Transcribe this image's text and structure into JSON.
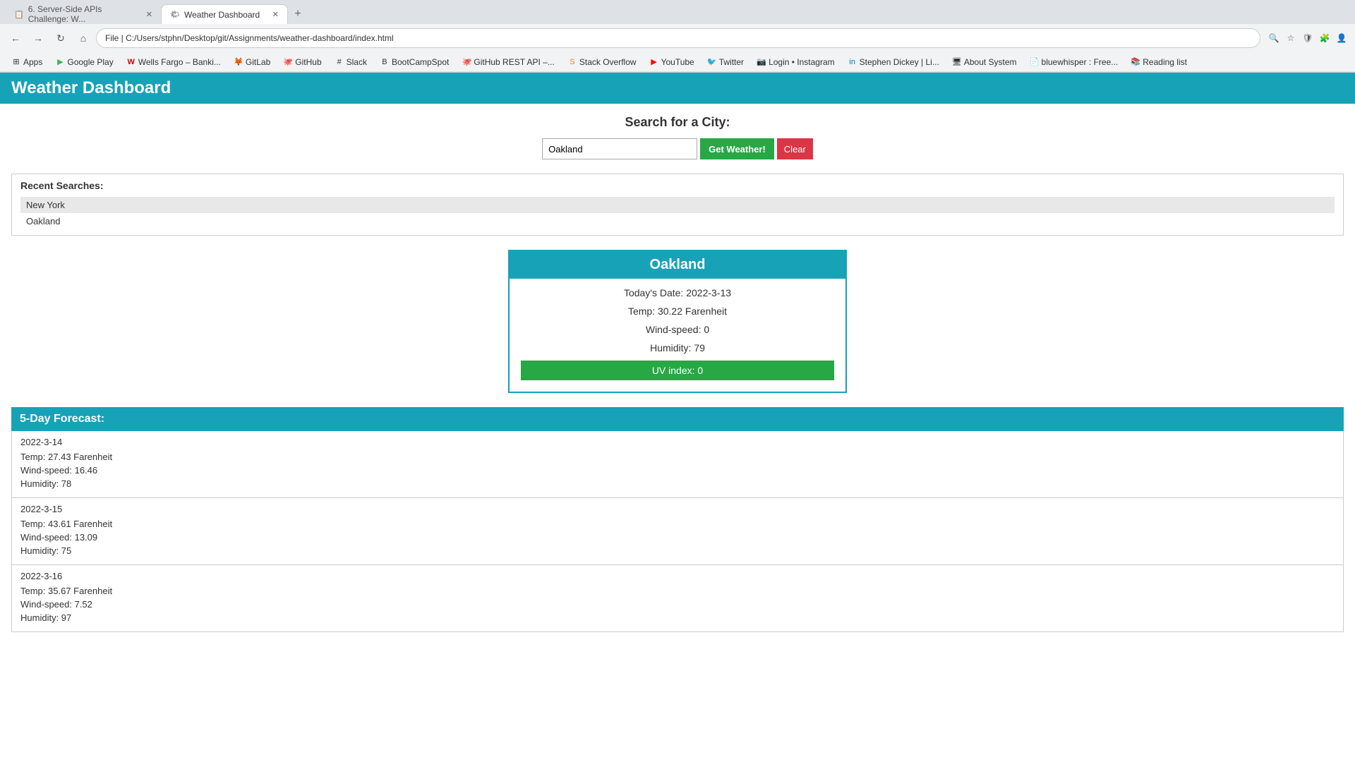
{
  "browser": {
    "tabs": [
      {
        "id": "tab1",
        "favicon": "📋",
        "title": "6. Server-Side APIs Challenge: W...",
        "active": false
      },
      {
        "id": "tab2",
        "favicon": "🌤",
        "title": "Weather Dashboard",
        "active": true
      }
    ],
    "new_tab_label": "+",
    "address_bar_value": "File | C:/Users/stphn/Desktop/git/Assignments/weather-dashboard/index.html",
    "bookmarks": [
      {
        "id": "bk-apps",
        "icon": "⊞",
        "label": "Apps"
      },
      {
        "id": "bk-google-play",
        "icon": "▶",
        "label": "Google Play"
      },
      {
        "id": "bk-wells-fargo",
        "icon": "W",
        "label": "Wells Fargo – Banki..."
      },
      {
        "id": "bk-gitlab",
        "icon": "🦊",
        "label": "GitLab"
      },
      {
        "id": "bk-github",
        "icon": "🐙",
        "label": "GitHub"
      },
      {
        "id": "bk-slack",
        "icon": "#",
        "label": "Slack"
      },
      {
        "id": "bk-bootcampspot",
        "icon": "B",
        "label": "BootCampSpot"
      },
      {
        "id": "bk-github-rest",
        "icon": "🐙",
        "label": "GitHub REST API –..."
      },
      {
        "id": "bk-stackoverflow",
        "icon": "S",
        "label": "Stack Overflow"
      },
      {
        "id": "bk-youtube",
        "icon": "▶",
        "label": "YouTube"
      },
      {
        "id": "bk-twitter",
        "icon": "🐦",
        "label": "Twitter"
      },
      {
        "id": "bk-instagram",
        "icon": "📷",
        "label": "Login • Instagram"
      },
      {
        "id": "bk-stephen-dickey",
        "icon": "in",
        "label": "Stephen Dickey | Li..."
      },
      {
        "id": "bk-about-system",
        "icon": "🖥",
        "label": "About System"
      },
      {
        "id": "bk-bluewhisper",
        "icon": "📄",
        "label": "bluewhisper : Free..."
      },
      {
        "id": "bk-reading-list",
        "icon": "📚",
        "label": "Reading list"
      }
    ]
  },
  "app": {
    "title": "Weather Dashboard"
  },
  "search": {
    "heading": "Search for a City:",
    "input_value": "Oakland",
    "input_placeholder": "Oakland",
    "get_weather_label": "Get Weather!",
    "clear_label": "Clear"
  },
  "recent_searches": {
    "heading": "Recent Searches:",
    "items": [
      {
        "id": "rs1",
        "city": "New York"
      },
      {
        "id": "rs2",
        "city": "Oakland"
      }
    ]
  },
  "current_weather": {
    "city": "Oakland",
    "date_label": "Today's Date: 2022-3-13",
    "temp_label": "Temp: 30.22 Farenheit",
    "wind_label": "Wind-speed: 0",
    "humidity_label": "Humidity: 79",
    "uv_label": "UV index: 0",
    "uv_color": "#28a745"
  },
  "forecast": {
    "heading": "5-Day Forecast:",
    "days": [
      {
        "id": "day1",
        "date": "2022-3-14",
        "temp": "Temp: 27.43 Farenheit",
        "wind": "Wind-speed: 16.46",
        "humidity": "Humidity: 78"
      },
      {
        "id": "day2",
        "date": "2022-3-15",
        "temp": "Temp: 43.61 Farenheit",
        "wind": "Wind-speed: 13.09",
        "humidity": "Humidity: 75"
      },
      {
        "id": "day3",
        "date": "2022-3-16",
        "temp": "Temp: 35.67 Farenheit",
        "wind": "Wind-speed: 7.52",
        "humidity": "Humidity: 97"
      }
    ]
  },
  "colors": {
    "teal": "#17a2b8",
    "green": "#28a745",
    "red": "#dc3545"
  }
}
